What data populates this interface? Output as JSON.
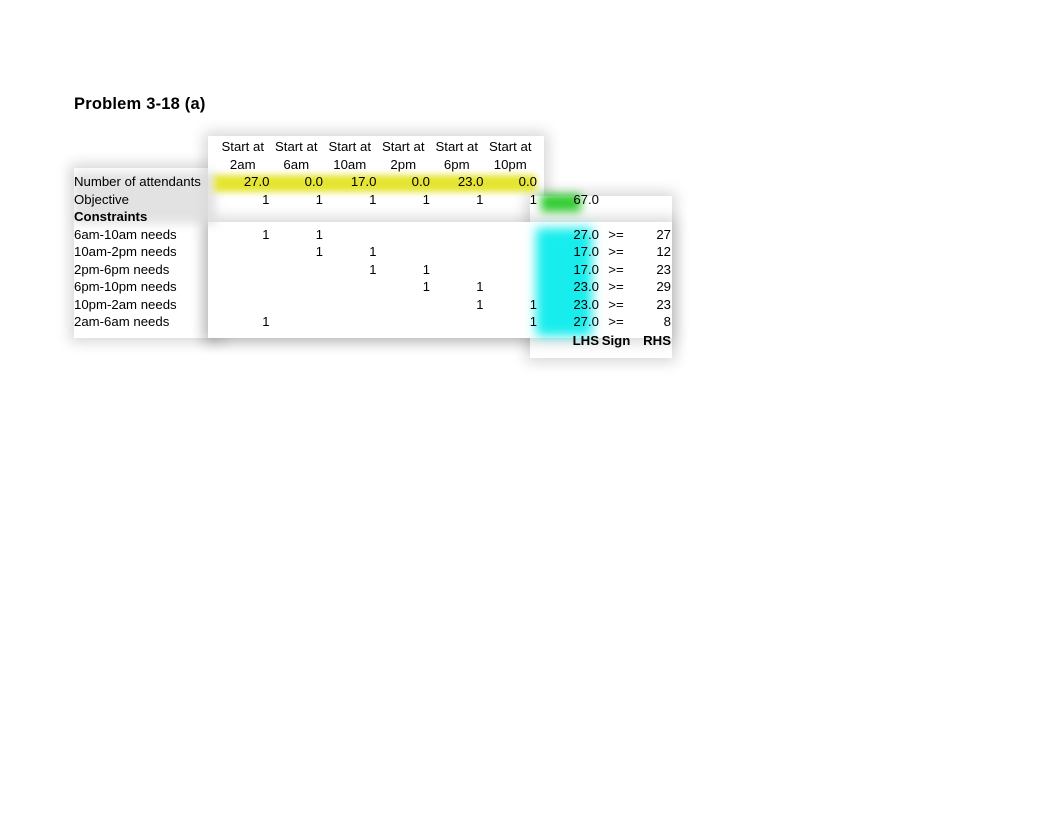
{
  "page": {
    "title": "Problem 3-18 (a)"
  },
  "colors": {
    "decision_row_highlight": "#e4e42a",
    "objective_cell_highlight": "#34cc34",
    "lhs_column_highlight": "#17eded",
    "label_shade": "#d9d9d9",
    "text": "#000000",
    "background": "#ffffff"
  },
  "model": {
    "variable_headers": [
      {
        "line1": "Start at",
        "line2": "2am"
      },
      {
        "line1": "Start at",
        "line2": "6am"
      },
      {
        "line1": "Start at",
        "line2": "10am"
      },
      {
        "line1": "Start at",
        "line2": "2pm"
      },
      {
        "line1": "Start at",
        "line2": "6pm"
      },
      {
        "line1": "Start at",
        "line2": "10pm"
      }
    ],
    "decision_row": {
      "label": "Number of attendants",
      "values": [
        "27.0",
        "0.0",
        "17.0",
        "0.0",
        "23.0",
        "0.0"
      ]
    },
    "objective_row": {
      "label": "Objective",
      "coefficients": [
        "1",
        "1",
        "1",
        "1",
        "1",
        "1"
      ],
      "value": "67.0"
    },
    "constraints_header": "Constraints",
    "constraints": [
      {
        "label": "6am-10am needs",
        "coefficients": [
          "1",
          "1",
          "",
          "",
          "",
          ""
        ],
        "lhs": "27.0",
        "sign": ">=",
        "rhs": "27"
      },
      {
        "label": "10am-2pm needs",
        "coefficients": [
          "",
          "1",
          "1",
          "",
          "",
          ""
        ],
        "lhs": "17.0",
        "sign": ">=",
        "rhs": "12"
      },
      {
        "label": "2pm-6pm needs",
        "coefficients": [
          "",
          "",
          "1",
          "1",
          "",
          ""
        ],
        "lhs": "17.0",
        "sign": ">=",
        "rhs": "23"
      },
      {
        "label": "6pm-10pm needs",
        "coefficients": [
          "",
          "",
          "",
          "1",
          "1",
          ""
        ],
        "lhs": "23.0",
        "sign": ">=",
        "rhs": "29"
      },
      {
        "label": "10pm-2am needs",
        "coefficients": [
          "",
          "",
          "",
          "",
          "1",
          "1"
        ],
        "lhs": "23.0",
        "sign": ">=",
        "rhs": "23"
      },
      {
        "label": "2am-6am needs",
        "coefficients": [
          "1",
          "",
          "",
          "",
          "",
          "1"
        ],
        "lhs": "27.0",
        "sign": ">=",
        "rhs": "8"
      }
    ],
    "footer": {
      "lhs_label": "LHS",
      "sign_label": "Sign",
      "rhs_label": "RHS"
    }
  }
}
